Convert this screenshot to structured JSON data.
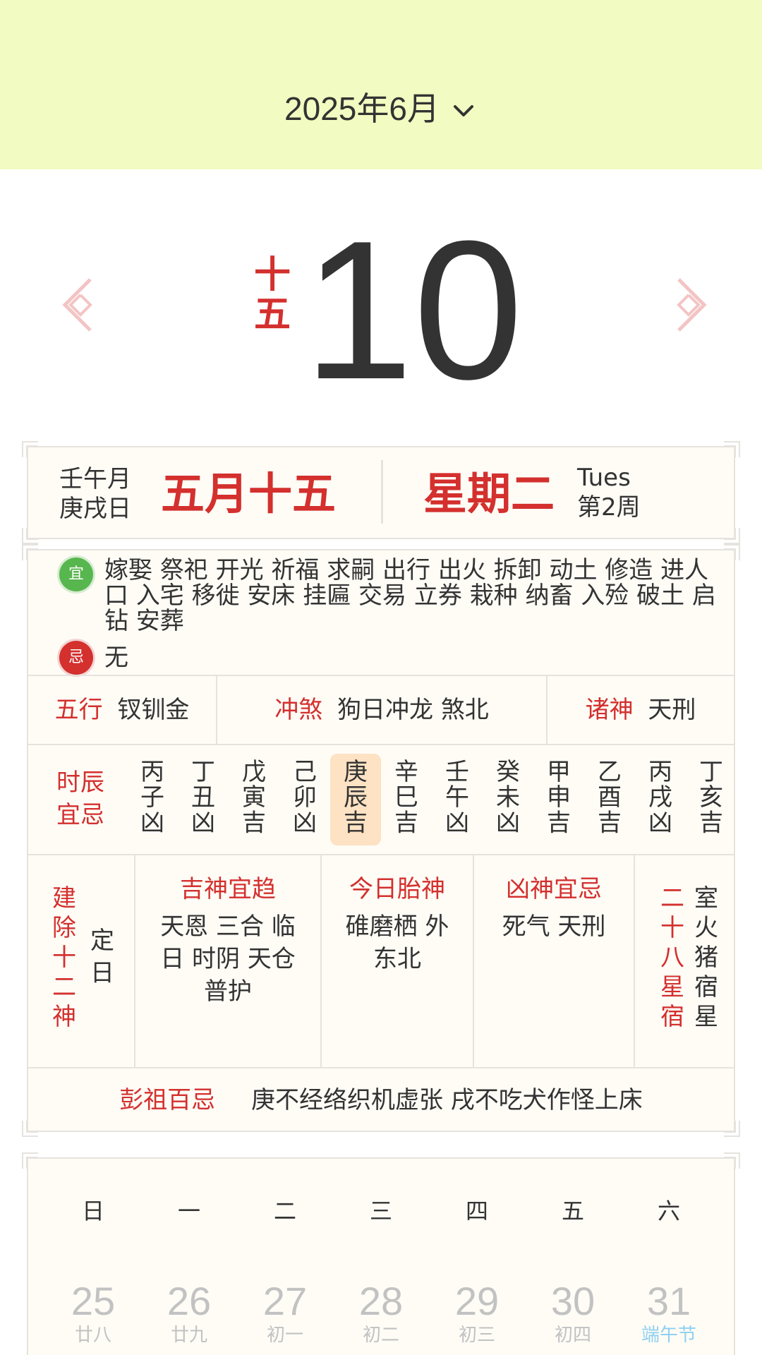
{
  "header": {
    "month_label": "2025年6月",
    "background": "#f2fbc1"
  },
  "today": {
    "lunar_day_vertical": [
      "十",
      "五"
    ],
    "day_number": "10"
  },
  "info": {
    "month_ganzhi": "壬午月",
    "day_ganzhi": "庚戌日",
    "lunar_date": "五月十五",
    "weekday": "星期二",
    "weekday_en": "Tues",
    "week_number": "第2周"
  },
  "yiji": {
    "yi_badge": "宜",
    "yi_text": "嫁娶 祭祀 开光 祈福 求嗣 出行 出火 拆卸 动土 修造 进人口 入宅 移徙 安床 挂匾 交易 立券 栽种 纳畜 入殓 破土 启钻 安葬",
    "ji_badge": "忌",
    "ji_text": "无"
  },
  "wuxing": {
    "label": "五行",
    "value": "钗钏金"
  },
  "chongsha": {
    "label": "冲煞",
    "value": "狗日冲龙 煞北"
  },
  "zhushen": {
    "label": "诸神",
    "value": "天刑"
  },
  "shichen": {
    "label_line1": "时辰",
    "label_line2": "宜忌",
    "hours": [
      {
        "stem": "丙",
        "branch": "子",
        "luck": "凶"
      },
      {
        "stem": "丁",
        "branch": "丑",
        "luck": "凶"
      },
      {
        "stem": "戊",
        "branch": "寅",
        "luck": "吉"
      },
      {
        "stem": "己",
        "branch": "卯",
        "luck": "凶"
      },
      {
        "stem": "庚",
        "branch": "辰",
        "luck": "吉"
      },
      {
        "stem": "辛",
        "branch": "巳",
        "luck": "吉"
      },
      {
        "stem": "壬",
        "branch": "午",
        "luck": "凶"
      },
      {
        "stem": "癸",
        "branch": "未",
        "luck": "凶"
      },
      {
        "stem": "甲",
        "branch": "申",
        "luck": "吉"
      },
      {
        "stem": "乙",
        "branch": "酉",
        "luck": "吉"
      },
      {
        "stem": "丙",
        "branch": "戌",
        "luck": "凶"
      },
      {
        "stem": "丁",
        "branch": "亥",
        "luck": "吉"
      }
    ],
    "active_index": 4
  },
  "jianchu": {
    "label": [
      "建",
      "除",
      "十",
      "二",
      "神"
    ],
    "value": [
      "定",
      "日"
    ]
  },
  "jishen": {
    "title": "吉神宜趋",
    "lines": [
      "天恩 三合 临",
      "日 时阴 天仓",
      "普护"
    ]
  },
  "taishen": {
    "title": "今日胎神",
    "lines": [
      "碓磨栖 外",
      "东北"
    ]
  },
  "xiongshen": {
    "title": "凶神宜忌",
    "lines": [
      "死气 天刑"
    ]
  },
  "xiu": {
    "label": [
      "二",
      "十",
      "八",
      "星",
      "宿"
    ],
    "value": [
      "室",
      "火",
      "猪",
      "宿",
      "星"
    ]
  },
  "pengzu": {
    "label": "彭祖百忌",
    "value": "庚不经络织机虚张 戌不吃犬作怪上床"
  },
  "calendar": {
    "weekday_headers": [
      "日",
      "一",
      "二",
      "三",
      "四",
      "五",
      "六"
    ],
    "days": [
      {
        "num": "25",
        "lunar": "廿八",
        "festival": false
      },
      {
        "num": "26",
        "lunar": "廿九",
        "festival": false
      },
      {
        "num": "27",
        "lunar": "初一",
        "festival": false
      },
      {
        "num": "28",
        "lunar": "初二",
        "festival": false
      },
      {
        "num": "29",
        "lunar": "初三",
        "festival": false
      },
      {
        "num": "30",
        "lunar": "初四",
        "festival": false
      },
      {
        "num": "31",
        "lunar": "端午节",
        "festival": true
      }
    ]
  },
  "colors": {
    "accent_red": "#d3302e",
    "yi_green": "#58b64e",
    "active_hour_bg": "#fde2c3",
    "festival_blue": "#8fd0f0"
  }
}
